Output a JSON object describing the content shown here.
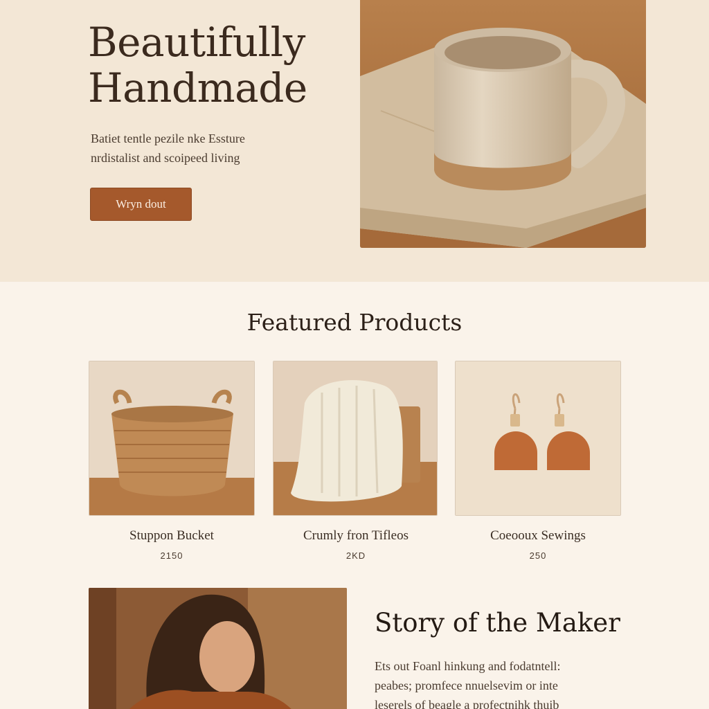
{
  "hero": {
    "title_line1": "Beautifully",
    "title_line2": "Handmade",
    "subtitle_line1": "Batiet tentle pezile nke Essture",
    "subtitle_line2": "nrdistalist and  scoipeed living",
    "button_label": "Wryn dout",
    "image_icon": "ceramic-mug-photo"
  },
  "featured": {
    "heading": "Featured Products",
    "products": [
      {
        "name": "Stuppon Bucket",
        "price": "2150",
        "image_icon": "woven-basket-photo"
      },
      {
        "name": "Crumly fron Tifleos",
        "price": "2KD",
        "image_icon": "knit-throw-photo"
      },
      {
        "name": "Coeooux Sewings",
        "price": "250",
        "image_icon": "clay-earrings-photo"
      }
    ]
  },
  "story": {
    "heading": "Story of the Maker",
    "body_line1": "Ets out Foanl hinkung and fodatntell:",
    "body_line2": "peabes; promfece nnuelsevim or inte",
    "body_line3": "leserels of beagle a profectnihk thuib",
    "image_icon": "maker-portrait-photo"
  },
  "colors": {
    "hero_bg": "#f3e7d6",
    "page_bg": "#faf3ea",
    "accent": "#a5592c",
    "text_dark": "#2f2218"
  }
}
